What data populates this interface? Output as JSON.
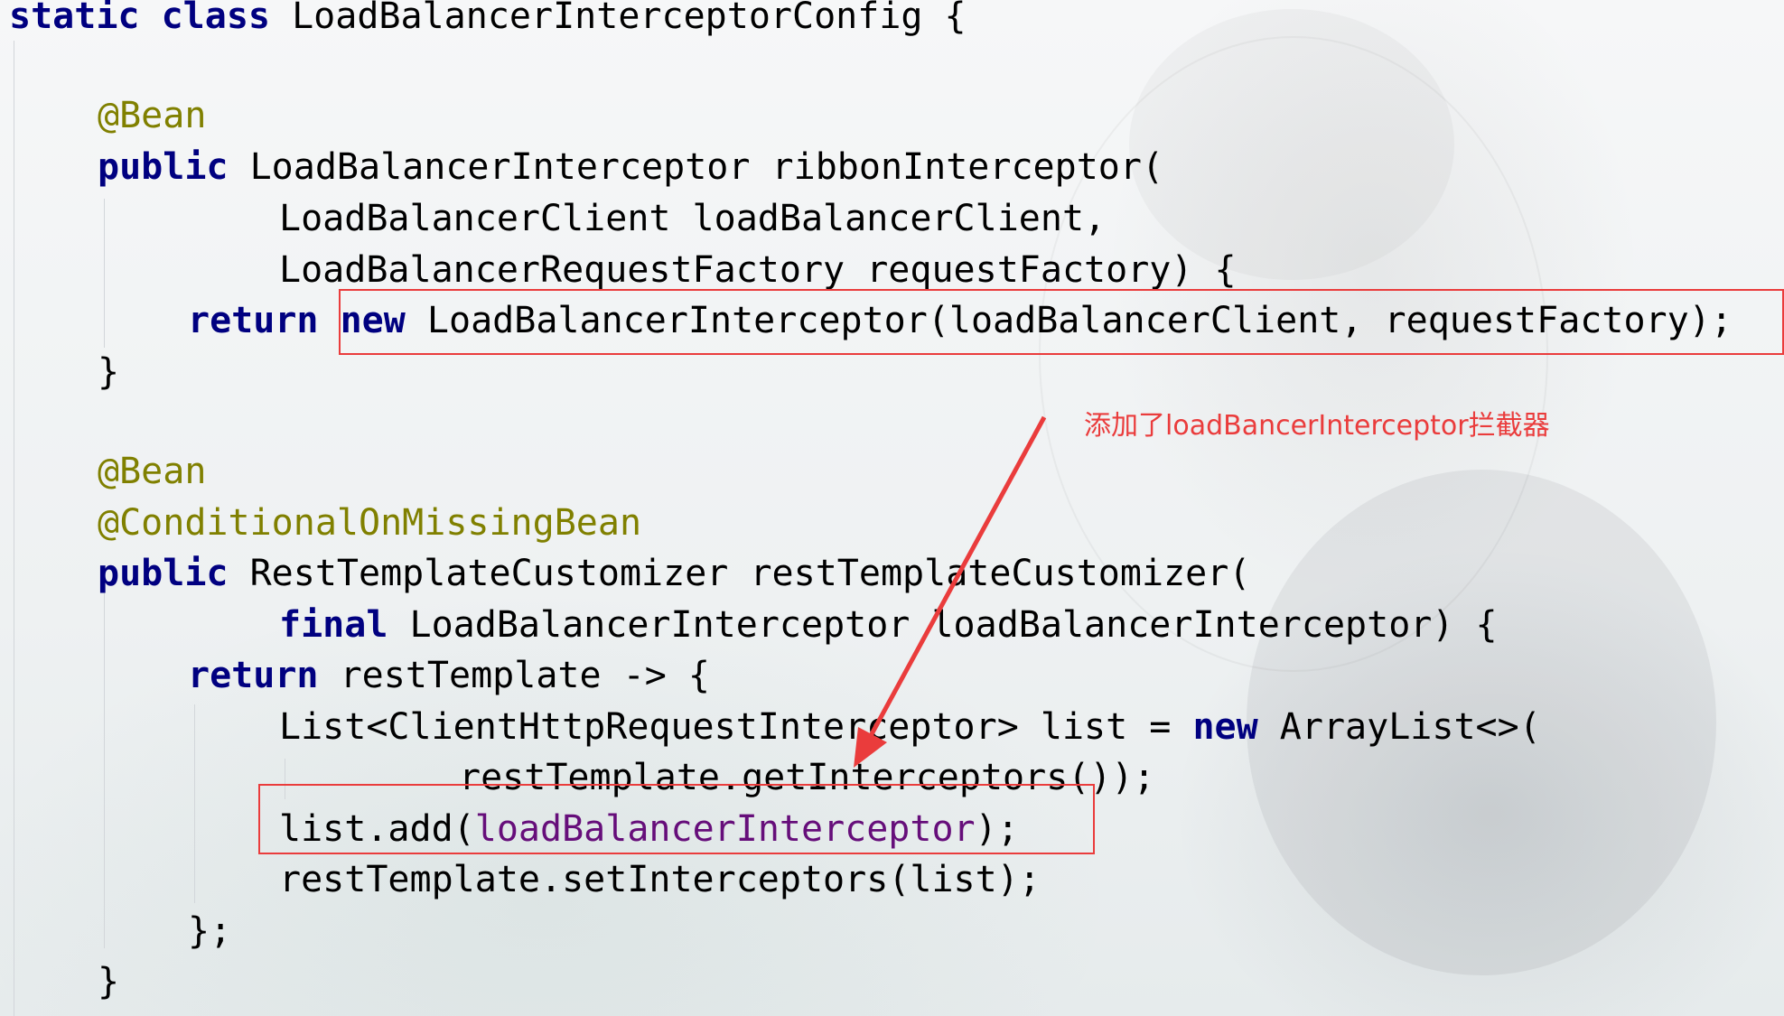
{
  "code": {
    "l1": {
      "kw1": "static",
      "kw2": "class",
      "rest": " LoadBalancerInterceptorConfig {"
    },
    "l2": {
      "ann": "@Bean"
    },
    "l3": {
      "kw": "public",
      "rest": " LoadBalancerInterceptor ribbonInterceptor("
    },
    "l4": {
      "text": "LoadBalancerClient loadBalancerClient,"
    },
    "l5": {
      "text": "LoadBalancerRequestFactory requestFactory) {"
    },
    "l6": {
      "kw": "return",
      "kw2": "new",
      "rest": " LoadBalancerInterceptor(loadBalancerClient, requestFactory);"
    },
    "l7": {
      "text": "}"
    },
    "l8": {
      "ann": "@Bean"
    },
    "l9": {
      "ann": "@ConditionalOnMissingBean"
    },
    "l10": {
      "kw": "public",
      "rest": " RestTemplateCustomizer restTemplateCustomizer("
    },
    "l11": {
      "kw": "final",
      "rest": " LoadBalancerInterceptor loadBalancerInterceptor) {"
    },
    "l12": {
      "kw": "return",
      "rest": " restTemplate -> {"
    },
    "l13": {
      "pre": "List<ClientHttpRequestInterceptor> list = ",
      "kw": "new",
      "post": " ArrayList<>("
    },
    "l14": {
      "text": "restTemplate.getInterceptors());"
    },
    "l15": {
      "pre": "list.add(",
      "field": "loadBalancerInterceptor",
      "post": ");"
    },
    "l16": {
      "text": "restTemplate.setInterceptors(list);"
    },
    "l17": {
      "text": "};"
    },
    "l18": {
      "text": "}"
    }
  },
  "annotation": {
    "callout_text": "添加了loadBancerInterceptor拦截器",
    "color": "#ea3c3c"
  },
  "colors": {
    "keyword": "#000080",
    "annotation": "#808000",
    "field": "#660e7a"
  }
}
